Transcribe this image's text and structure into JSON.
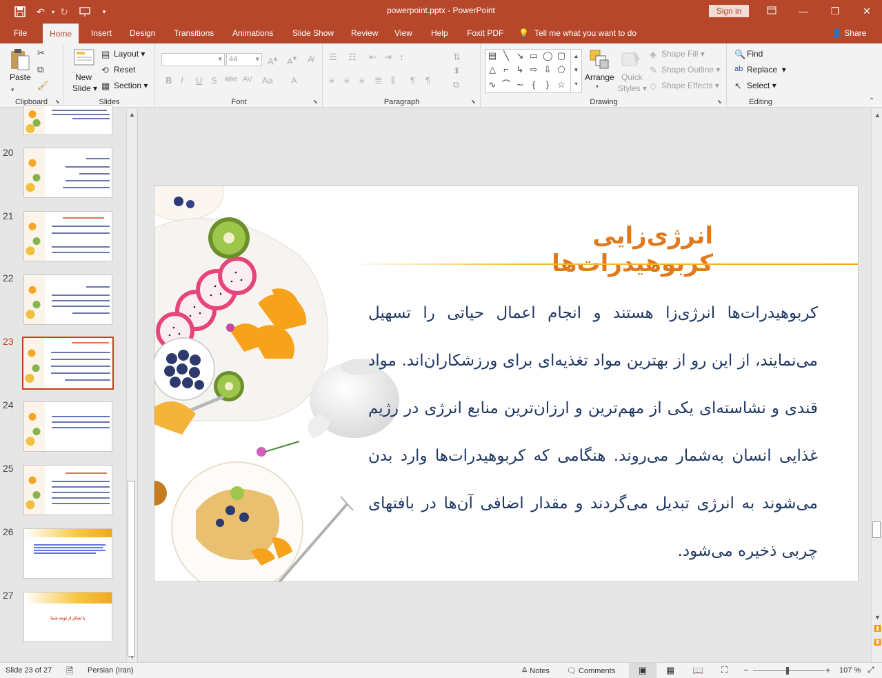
{
  "window": {
    "title": "powerpoint.pptx  -  PowerPoint",
    "signin_label": "Sign in"
  },
  "tabs": [
    {
      "label": "File"
    },
    {
      "label": "Home"
    },
    {
      "label": "Insert"
    },
    {
      "label": "Design"
    },
    {
      "label": "Transitions"
    },
    {
      "label": "Animations"
    },
    {
      "label": "Slide Show"
    },
    {
      "label": "Review"
    },
    {
      "label": "View"
    },
    {
      "label": "Help"
    },
    {
      "label": "Foxit PDF"
    }
  ],
  "tellme": "Tell me what you want to do",
  "share": "Share",
  "ribbon": {
    "clipboard": {
      "paste": "Paste",
      "label": "Clipboard"
    },
    "slides": {
      "new_slide_1": "New",
      "new_slide_2": "Slide",
      "layout": "Layout",
      "reset": "Reset",
      "section": "Section",
      "label": "Slides"
    },
    "font": {
      "size": "44",
      "label": "Font"
    },
    "paragraph": {
      "label": "Paragraph"
    },
    "drawing": {
      "arrange": "Arrange",
      "quick_styles_1": "Quick",
      "quick_styles_2": "Styles",
      "shape_fill": "Shape Fill",
      "shape_outline": "Shape Outline",
      "shape_effects": "Shape Effects",
      "label": "Drawing"
    },
    "editing": {
      "find": "Find",
      "replace": "Replace",
      "select": "Select",
      "label": "Editing"
    }
  },
  "thumbnails": [
    {
      "num": "20"
    },
    {
      "num": "21"
    },
    {
      "num": "22"
    },
    {
      "num": "23"
    },
    {
      "num": "24"
    },
    {
      "num": "25"
    },
    {
      "num": "26"
    },
    {
      "num": "27"
    }
  ],
  "slide": {
    "title": "انرژی‌زایی کربوهیدرات‌ها",
    "body": "کربوهیدرات‌ها انرژی‌زا هستند و انجام اعمال حیاتی را تسهیل می‌نمایند، از این رو از بهترین مواد تغذیه‌ای برای ورزشکاران‌اند. مواد قندی و نشاسته‌ای یکی از مهم‌ترین و ارزان‌ترین منابع انرژی در رژیم غذایی انسان به‌شمار می‌روند. هنگامی که کربوهیدرات‌ها وارد بدن می‌شوند به انرژی تبدیل می‌گردند و مقدار اضافی آن‌ها در بافتهای چربی ذخیره می‌شود.",
    "thumb27_text": "با تشکر از توجه شما"
  },
  "status": {
    "slide_info": "Slide 23 of 27",
    "language": "Persian (Iran)",
    "notes": "Notes",
    "comments": "Comments",
    "zoom": "107 %"
  }
}
